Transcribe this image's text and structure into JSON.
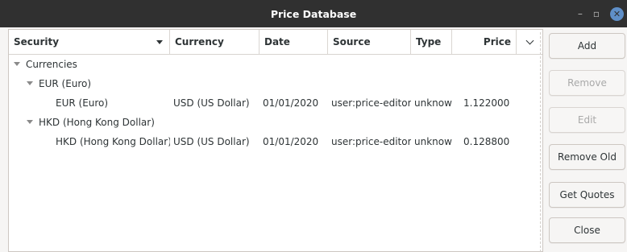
{
  "window": {
    "title": "Price Database",
    "minimize_glyph": "–",
    "maximize_glyph": "▫",
    "close_glyph": "✕"
  },
  "columns": [
    {
      "label": "Security"
    },
    {
      "label": "Currency"
    },
    {
      "label": "Date"
    },
    {
      "label": "Source"
    },
    {
      "label": "Type"
    },
    {
      "label": "Price"
    }
  ],
  "rows": [
    {
      "security": "Currencies",
      "currency": "",
      "date": "",
      "source": "",
      "type": "",
      "price": ""
    },
    {
      "security": "EUR (Euro)",
      "currency": "",
      "date": "",
      "source": "",
      "type": "",
      "price": ""
    },
    {
      "security": "EUR (Euro)",
      "currency": "USD (US Dollar)",
      "date": "01/01/2020",
      "source": "user:price-editor",
      "type": "unknow",
      "price": "1.122000"
    },
    {
      "security": "HKD (Hong Kong Dollar)",
      "currency": "",
      "date": "",
      "source": "",
      "type": "",
      "price": ""
    },
    {
      "security": "HKD (Hong Kong Dollar)",
      "currency": "USD (US Dollar)",
      "date": "01/01/2020",
      "source": "user:price-editor",
      "type": "unknow",
      "price": "0.128800"
    }
  ],
  "buttons": {
    "add": "Add",
    "remove": "Remove",
    "edit": "Edit",
    "remove_old": "Remove Old",
    "get_quotes": "Get Quotes",
    "close": "Close"
  }
}
